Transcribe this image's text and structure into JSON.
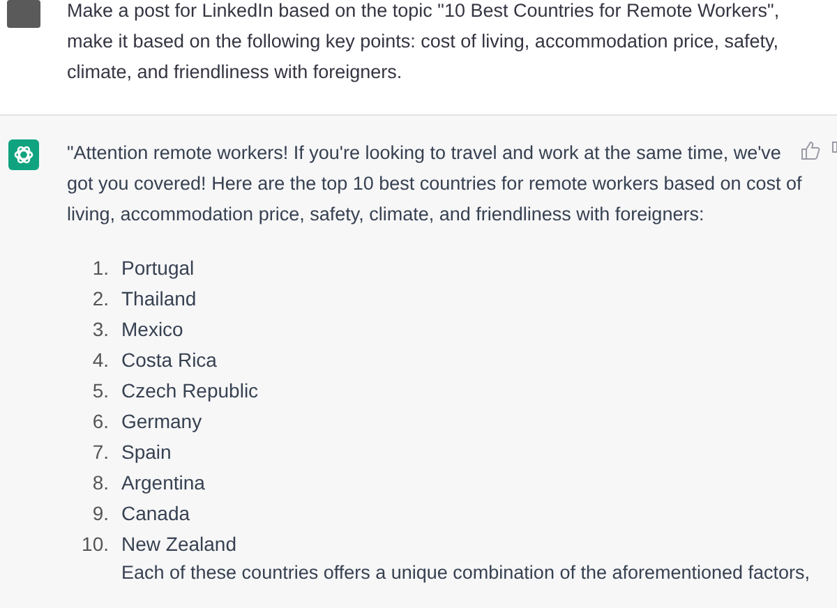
{
  "user_message": {
    "text": "Make a post for LinkedIn based on the topic \"10 Best Countries for Remote Workers\", make it based on the following key points: cost of living, accommodation price, safety, climate, and friendliness with foreigners."
  },
  "assistant_message": {
    "intro": "\"Attention remote workers! If you're looking to travel and work at the same time, we've got you covered! Here are the top 10 best countries for remote workers based on cost of living, accommodation price, safety, climate, and friendliness with foreigners:",
    "list": [
      {
        "number": "1.",
        "text": "Portugal"
      },
      {
        "number": "2.",
        "text": "Thailand"
      },
      {
        "number": "3.",
        "text": "Mexico"
      },
      {
        "number": "4.",
        "text": "Costa Rica"
      },
      {
        "number": "5.",
        "text": "Czech Republic"
      },
      {
        "number": "6.",
        "text": "Germany"
      },
      {
        "number": "7.",
        "text": "Spain"
      },
      {
        "number": "8.",
        "text": "Argentina"
      },
      {
        "number": "9.",
        "text": "Canada"
      },
      {
        "number": "10.",
        "text": "New Zealand"
      }
    ],
    "closing": "Each of these countries offers a unique combination of the aforementioned factors,"
  }
}
